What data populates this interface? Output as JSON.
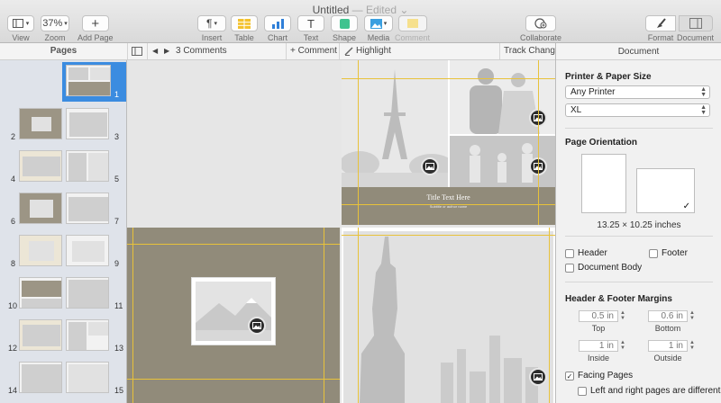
{
  "window": {
    "title": "Untitled",
    "edited": " — Edited ⌄"
  },
  "toolbar": {
    "view": "View",
    "zoom": "Zoom",
    "zoom_value": "37%",
    "add_page": "Add Page",
    "insert": "Insert",
    "table": "Table",
    "chart": "Chart",
    "text": "Text",
    "shape": "Shape",
    "media": "Media",
    "comment": "Comment",
    "collaborate": "Collaborate",
    "format": "Format",
    "document": "Document"
  },
  "subbar": {
    "comments_count": "3 Comments",
    "add_comment": "+ Comment",
    "highlight": "Highlight",
    "track_changes": "Track Changes"
  },
  "pages": {
    "header": "Pages",
    "numbers": [
      "1",
      "2",
      "3",
      "4",
      "5",
      "6",
      "7",
      "8",
      "9",
      "10",
      "11",
      "12",
      "13",
      "14",
      "15"
    ]
  },
  "canvas": {
    "title_placeholder": "Title Text Here",
    "subtitle_placeholder": "Subtitle or author name"
  },
  "inspector": {
    "tab": "Document",
    "printer_section": "Printer & Paper Size",
    "printer": "Any Printer",
    "paper": "XL",
    "orientation_section": "Page Orientation",
    "paper_dims": "13.25 × 10.25 inches",
    "header_cb": "Header",
    "footer_cb": "Footer",
    "body_cb": "Document Body",
    "margins_section": "Header & Footer Margins",
    "top_val": "0.5 in",
    "top_lbl": "Top",
    "bottom_val": "0.6 in",
    "bottom_lbl": "Bottom",
    "inside_val": "1 in",
    "inside_lbl": "Inside",
    "outside_val": "1 in",
    "outside_lbl": "Outside",
    "facing_cb": "Facing Pages",
    "lr_diff_cb": "Left and right pages are different"
  },
  "colors": {
    "accent": "#3b8ce0",
    "guide": "#e8c23a",
    "olive": "#918b7a"
  }
}
